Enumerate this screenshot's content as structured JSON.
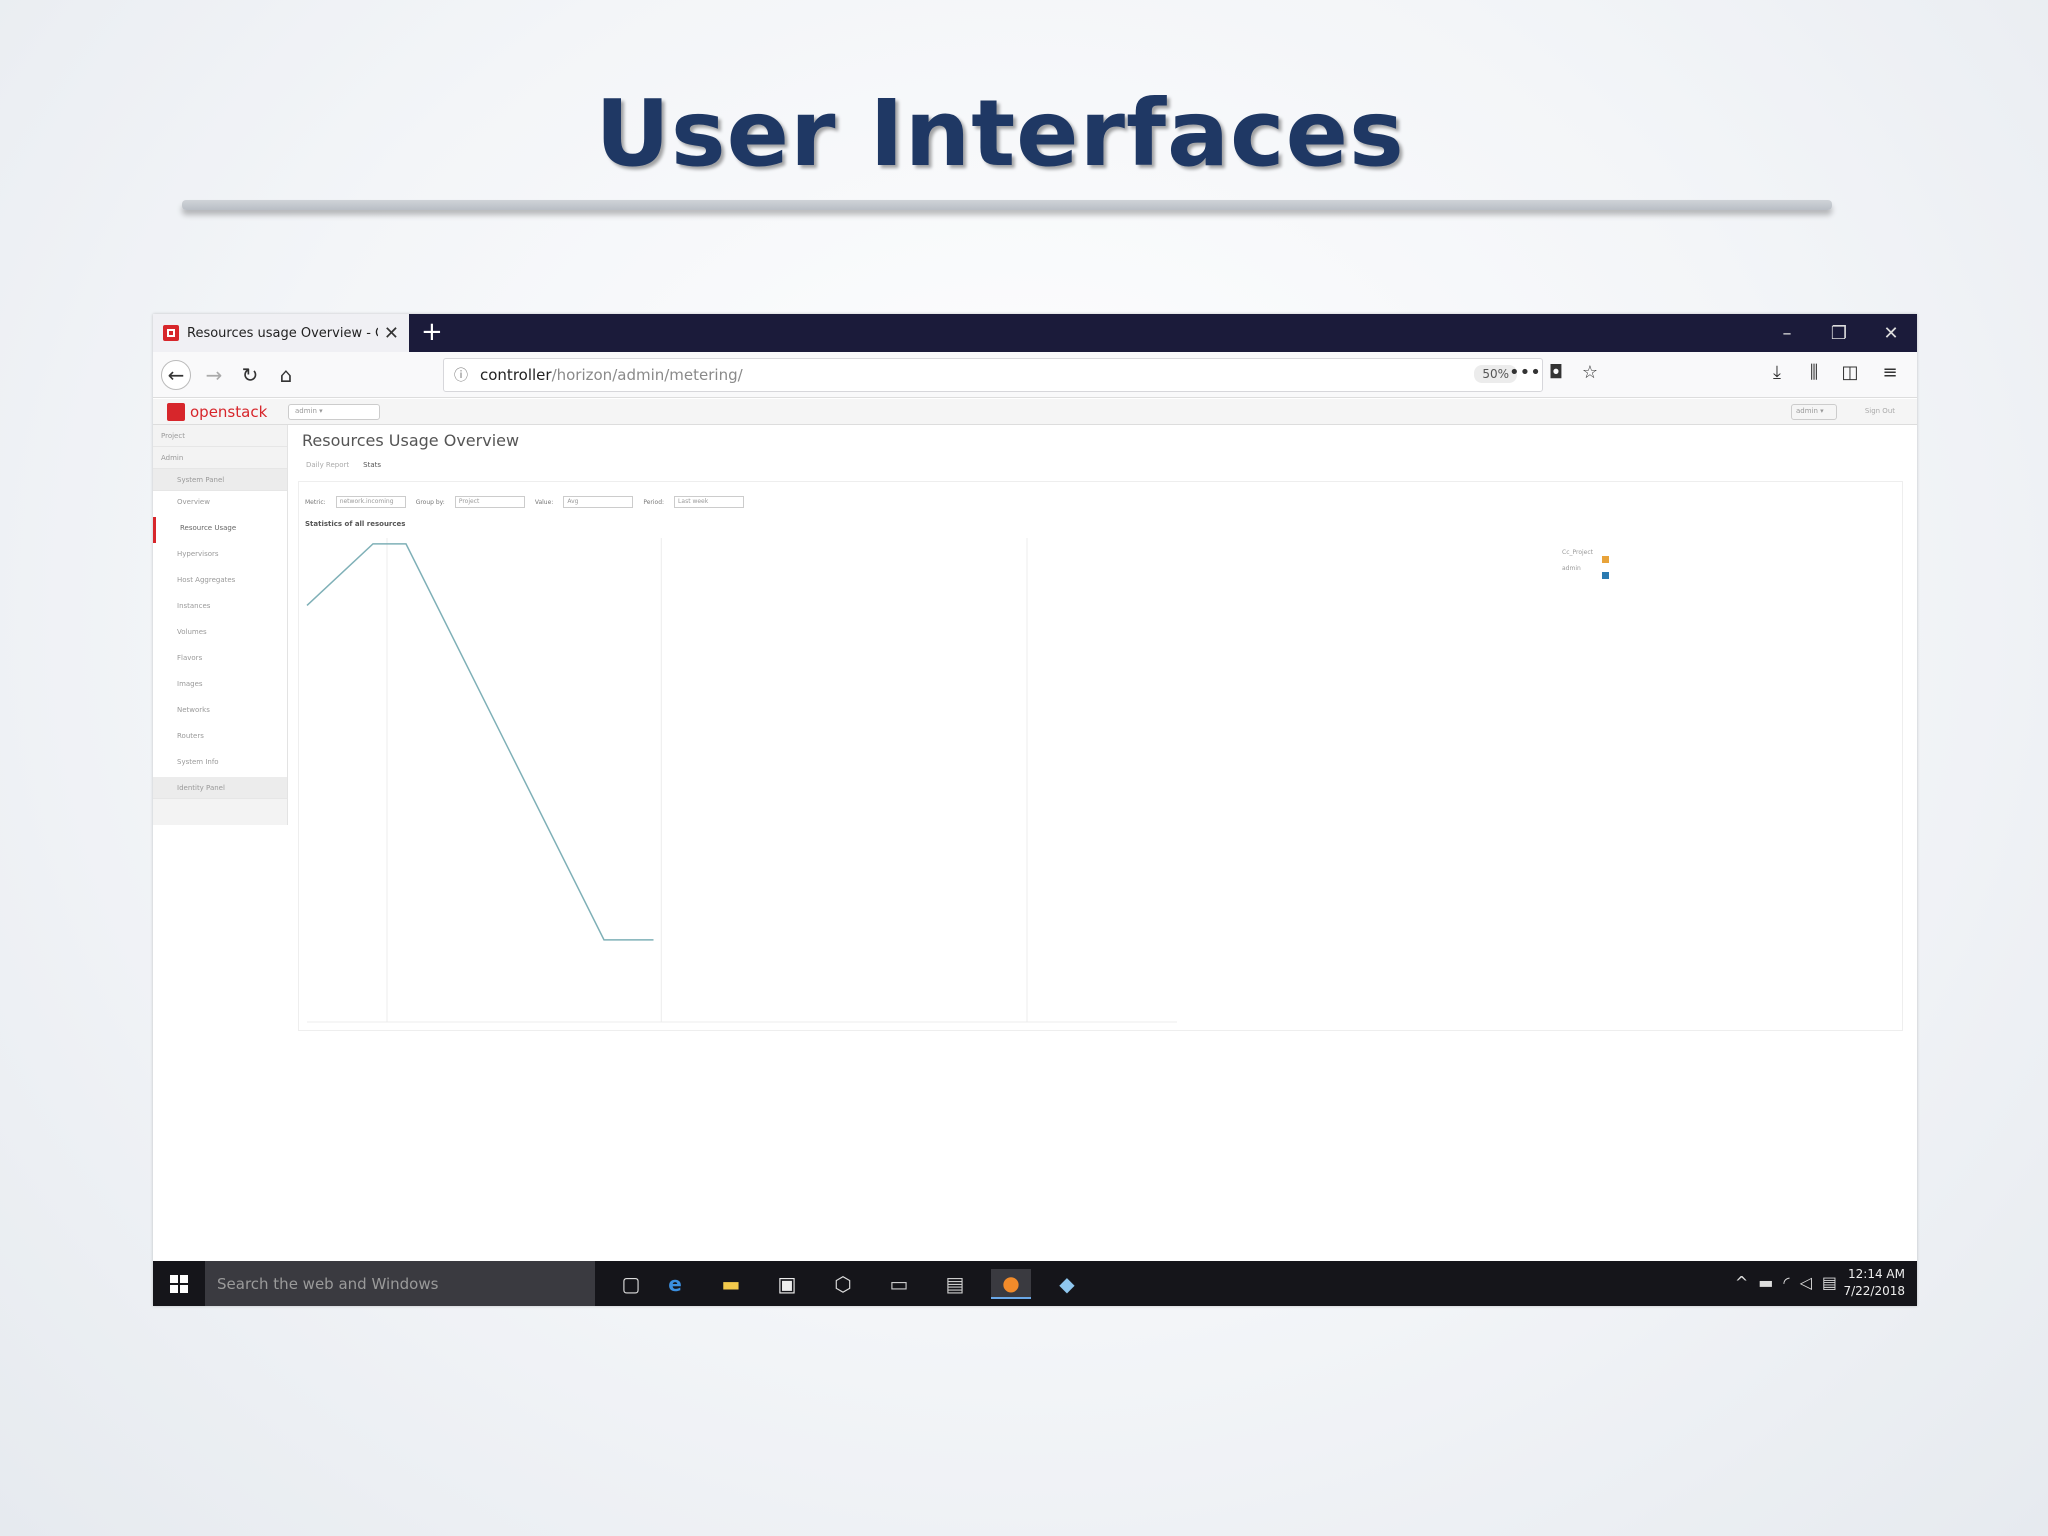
{
  "slide": {
    "title": "User Interfaces"
  },
  "browser": {
    "tab_title": "Resources usage Overview - Op",
    "tab_close": "✕",
    "new_tab": "+",
    "window": {
      "minimize": "–",
      "restore": "❐",
      "close": "✕"
    },
    "url_host": "controller",
    "url_path": "/horizon/admin/metering/",
    "zoom": "50%"
  },
  "app": {
    "logo_text": "openstack",
    "project_selector": "admin ▾",
    "user_menu": "admin ▾",
    "sign_out": "Sign Out",
    "page_title": "Resources Usage Overview",
    "sidebar": [
      {
        "label": "Project",
        "level": 1
      },
      {
        "label": "Admin",
        "level": 1
      },
      {
        "label": "System Panel",
        "level": 2
      },
      {
        "label": "Overview",
        "level": 3
      },
      {
        "label": "Resource Usage",
        "level": 3
      },
      {
        "label": "Hypervisors",
        "level": 3
      },
      {
        "label": "Host Aggregates",
        "level": 3
      },
      {
        "label": "Instances",
        "level": 3
      },
      {
        "label": "Volumes",
        "level": 3
      },
      {
        "label": "Flavors",
        "level": 3
      },
      {
        "label": "Images",
        "level": 3
      },
      {
        "label": "Networks",
        "level": 3
      },
      {
        "label": "Routers",
        "level": 3
      },
      {
        "label": "System Info",
        "level": 3
      },
      {
        "label": "Identity Panel",
        "level": 2
      }
    ],
    "subtabs": [
      "Daily Report",
      "Stats"
    ],
    "filters": [
      {
        "label": "Metric:",
        "value": "network.incoming"
      },
      {
        "label": "Group by:",
        "value": "Project"
      },
      {
        "label": "Value:",
        "value": "Avg"
      },
      {
        "label": "Period:",
        "value": "Last week"
      }
    ],
    "chart_heading": "Statistics of all resources"
  },
  "chart_data": {
    "type": "line",
    "title": "Statistics of all resources",
    "x": [
      0,
      1,
      1.5,
      3,
      3.5
    ],
    "series": [
      {
        "name": "Cc_Project",
        "color": "#e8a33a",
        "values": []
      },
      {
        "name": "admin",
        "color": "#2a7ab0",
        "values": [
          14200,
          16300,
          16300,
          2800,
          2800
        ]
      }
    ],
    "ylim": [
      0,
      16500
    ],
    "grid": true,
    "legend": "top-right",
    "line_color": "#7fb0b7"
  },
  "taskbar": {
    "search_placeholder": "Search the web and Windows",
    "time": "12:14 AM",
    "date": "7/22/2018"
  }
}
